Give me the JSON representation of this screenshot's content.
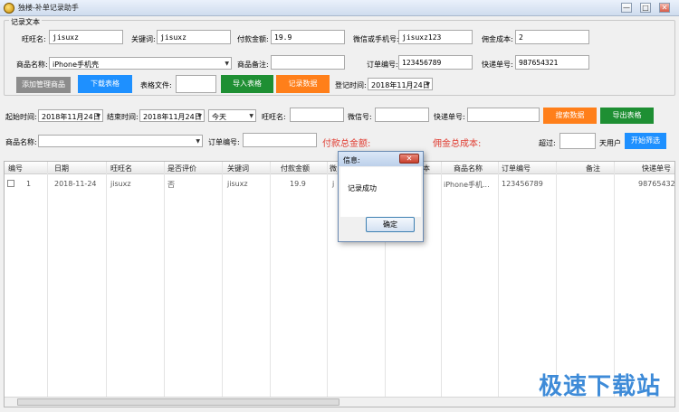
{
  "window": {
    "title": "独楼-补单记录助手",
    "min": "—",
    "max": "□",
    "close": "✕"
  },
  "record_group": {
    "title": "记录文本",
    "wangwang_label": "旺旺名:",
    "wangwang_value": "jisuxz",
    "keyword_label": "关键词:",
    "keyword_value": "jisuxz",
    "payment_label": "付款金额:",
    "payment_value": "19.9",
    "wechat_label": "微信或手机号:",
    "wechat_value": "jisuxz123",
    "commission_label": "佣金成本:",
    "commission_value": "2",
    "product_label": "商品名称:",
    "product_value": "iPhone手机壳",
    "remark_label": "商品备注:",
    "remark_value": "",
    "order_label": "订单编号:",
    "order_value": "123456789",
    "express_label": "快递单号:",
    "express_value": "987654321",
    "add_product_btn": "添加管理商品",
    "download_btn": "下载表格",
    "table_file_label": "表格文件:",
    "table_file_value": "",
    "import_btn": "导入表格",
    "record_btn": "记录数据",
    "record_time_label": "登记时间:",
    "record_time_value": "2018年11月24日"
  },
  "search": {
    "start_label": "起始时间:",
    "start_value": "2018年11月24日",
    "end_label": "结束时间:",
    "end_value": "2018年11月24日",
    "range_value": "今天",
    "wangwang_label": "旺旺名:",
    "wechat_label": "微信号:",
    "express_label": "快递单号:",
    "search_btn": "搜索数据",
    "export_btn": "导出表格",
    "product_label": "商品名称:",
    "order_label": "订单编号:",
    "total_payment_label": "付款总金额:",
    "total_commission_label": "佣金总成本:",
    "exceed_label": "超过:",
    "days_label": "天用户",
    "filter_btn": "开始筛选"
  },
  "table": {
    "headers": [
      "编号",
      "日期",
      "旺旺名",
      "是否评价",
      "关键词",
      "付款金额",
      "微",
      "本",
      "商品名称",
      "订单编号",
      "备注",
      "快递单号"
    ],
    "row": [
      "1",
      "2018-11-24",
      "jisuxz",
      "否",
      "jisuxz",
      "19.9",
      "j",
      "",
      "iPhone手机...",
      "123456789",
      "",
      "98765432"
    ]
  },
  "dialog": {
    "title": "信息:",
    "message": "记录成功",
    "ok": "确定",
    "close": "✕"
  },
  "watermark": "极速下载站"
}
